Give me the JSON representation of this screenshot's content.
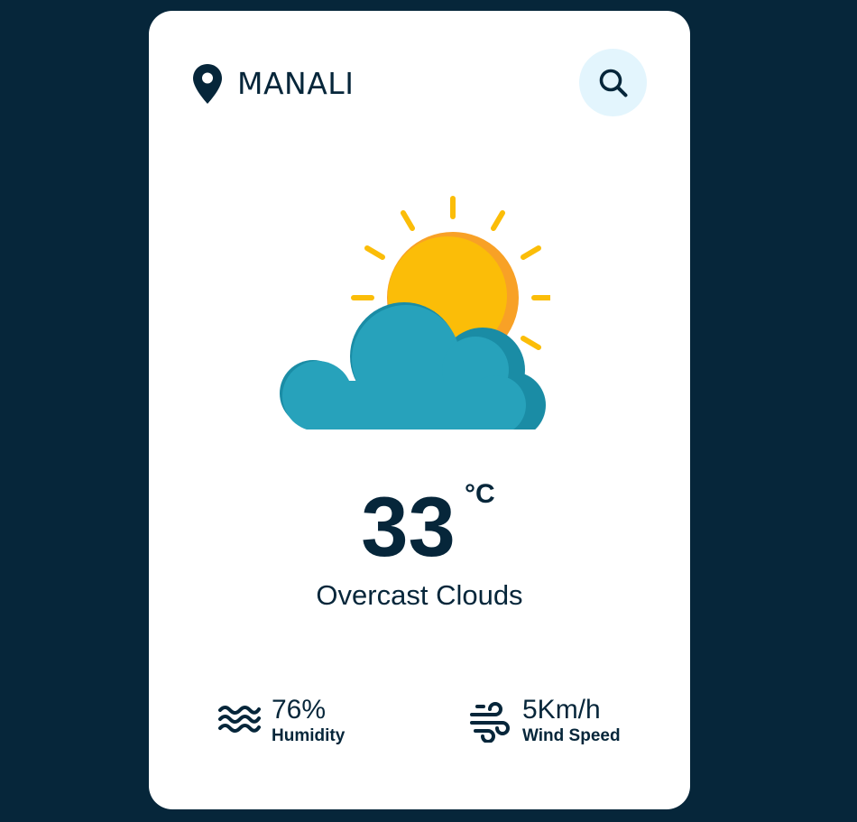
{
  "location": {
    "icon": "map-pin-icon",
    "name": "MANALI"
  },
  "search": {
    "icon": "search-icon"
  },
  "weather": {
    "icon": "partly-cloudy-sun-icon",
    "temperature": "33",
    "unit": "°C",
    "condition": "Overcast Clouds"
  },
  "stats": {
    "humidity": {
      "icon": "waves-icon",
      "value": "76%",
      "label": "Humidity"
    },
    "wind": {
      "icon": "wind-icon",
      "value": "5Km/h",
      "label": "Wind Speed"
    }
  },
  "colors": {
    "background": "#06263a",
    "card": "#ffffff",
    "text": "#06263a",
    "search_button_bg": "#e3f5fd",
    "sun": "#fbbd08",
    "sun_shade": "#f8a126",
    "cloud": "#27a2bb",
    "cloud_shade": "#1a8ca5"
  }
}
